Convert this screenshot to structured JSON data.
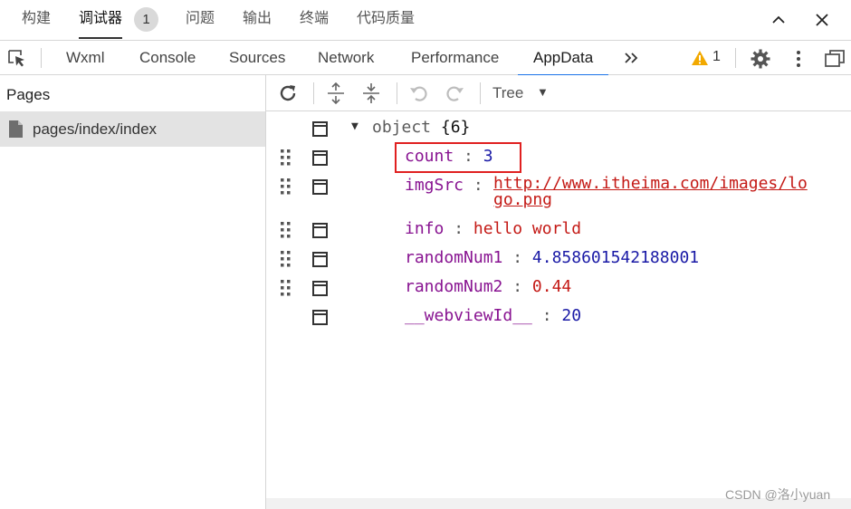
{
  "top_tabs": [
    {
      "label": "构建"
    },
    {
      "label": "调试器"
    },
    {
      "label": "问题"
    },
    {
      "label": "输出"
    },
    {
      "label": "终端"
    },
    {
      "label": "代码质量"
    }
  ],
  "debugger_badge": "1",
  "dev_tabs": [
    {
      "label": "Wxml"
    },
    {
      "label": "Console"
    },
    {
      "label": "Sources"
    },
    {
      "label": "Network"
    },
    {
      "label": "Performance"
    },
    {
      "label": "AppData"
    }
  ],
  "warning_count": "1",
  "pages": {
    "title": "Pages",
    "items": [
      {
        "label": "pages/index/index"
      }
    ]
  },
  "view_mode": "Tree",
  "tree": {
    "root_label": "object",
    "root_count": "{6}",
    "entries": [
      {
        "key": "count",
        "value": "3",
        "type": "number"
      },
      {
        "key": "imgSrc",
        "value_line1": "http://www.itheima.com/images/lo",
        "value_line2": "go.png",
        "type": "link"
      },
      {
        "key": "info",
        "value": "hello world",
        "type": "string"
      },
      {
        "key": "randomNum1",
        "value": "4.858601542188001",
        "type": "number"
      },
      {
        "key": "randomNum2",
        "value": "0.44",
        "type": "string"
      },
      {
        "key": "__webviewId__",
        "value": "20",
        "type": "number"
      }
    ]
  },
  "watermark": "CSDN @洛小yuan",
  "colors": {
    "accent_tab": "#1a73e8",
    "key": "#881391",
    "number": "#1a1aa6",
    "string": "#c41a16",
    "highlight_box": "#e02020",
    "warning": "#f2a900"
  }
}
